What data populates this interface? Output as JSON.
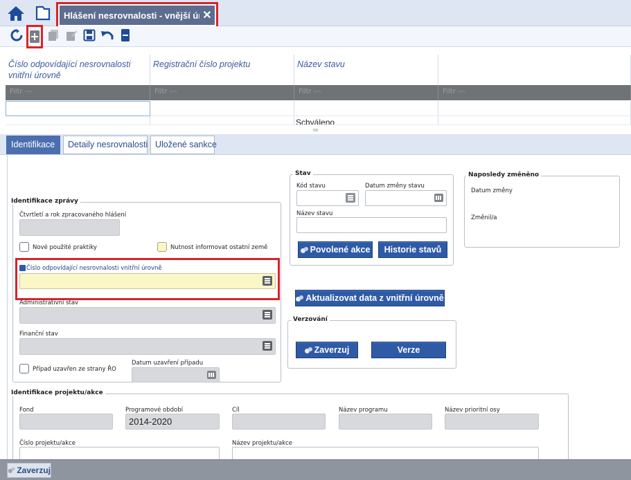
{
  "window": {
    "tab_title": "Hlášení nesrovnalosti - vnější úroveň",
    "close_glyph": "✕"
  },
  "toolbar": {
    "icons": [
      "refresh-icon",
      "add-icon",
      "copy-icon",
      "edit-icon",
      "save-icon",
      "undo-icon",
      "delete-icon"
    ]
  },
  "grid": {
    "columns": [
      "Číslo odpovídající nesrovnalosti vnitřní úrovně",
      "Registrační číslo projektu",
      "Název stavu",
      ""
    ],
    "filter_placeholder": "Filtr ---",
    "rows": [
      [
        "",
        "",
        "",
        ""
      ],
      [
        "",
        "",
        "Schváleno",
        ""
      ]
    ]
  },
  "tabs": [
    {
      "label": "Identifikace",
      "active": true
    },
    {
      "label": "Detaily nesrovnalosti",
      "active": false
    },
    {
      "label": "Uložené sankce",
      "active": false
    }
  ],
  "identifikace_zpravy": {
    "legend": "Identifikace zprávy",
    "ctvrtleti_label": "Čtvrtletí a rok zpracovaného hlášení",
    "nove_praktiky_label": "Nové použité praktiky",
    "nutnost_label": "Nutnost informovat ostatní země",
    "cislo_label": "Číslo odpovídající nesrovnalosti vnitřní úrovně",
    "admin_stav_label": "Administrativní stav",
    "financni_stav_label": "Finanční stav",
    "pripad_label": "Případ uzavřen ze strany ŘO",
    "datum_uzavreni_label": "Datum uzavření případu"
  },
  "stav": {
    "legend": "Stav",
    "kod_label": "Kód stavu",
    "datum_zmeny_label": "Datum změny stavu",
    "nazev_label": "Název stavu",
    "povolene_btn": "Povolené akce",
    "historie_btn": "Historie stavů"
  },
  "naposledy": {
    "legend": "Naposledy změněno",
    "datum_label": "Datum změny",
    "zmenil_label": "Změnil/a"
  },
  "aktualizovat_btn": "Aktualizovat data z vnitřní úrovně",
  "verzovani": {
    "legend": "Verzování",
    "zaverzuj_btn": "Zaverzuj",
    "verze_btn": "Verze"
  },
  "projekt": {
    "legend": "Identifikace projektu/akce",
    "fond_label": "Fond",
    "obdobi_label": "Programové období",
    "obdobi_value": "2014-2020",
    "cil_label": "Cíl",
    "program_label": "Název programu",
    "osa_label": "Název prioritní osy",
    "cislo_projektu_label": "Číslo projektu/akce",
    "nazev_projektu_label": "Název projektu/akce"
  },
  "footer": {
    "zaverzuj_label": "Zaverzuj"
  },
  "colors": {
    "accent": "#2f5aa5",
    "highlight_red": "#d8232a",
    "required_yellow": "#fbf6c6"
  }
}
